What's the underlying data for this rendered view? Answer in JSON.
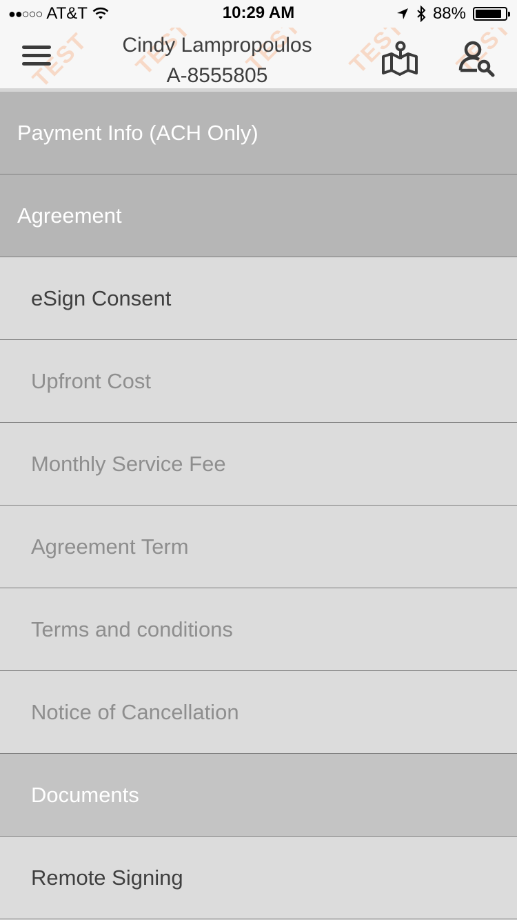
{
  "status_bar": {
    "signal_dots": "●●○○○",
    "carrier": "AT&T",
    "time": "10:29 AM",
    "battery_text": "88%",
    "battery_level": 0.88
  },
  "header": {
    "customer_name": "Cindy Lampropoulos",
    "account_id": "A-8555805",
    "watermark_text": "TEST"
  },
  "colors": {
    "section_bg": "#b6b6b6",
    "item_bg": "#dcdcdc",
    "watermark": "#f5a06e"
  },
  "icons": {
    "menu": "hamburger-menu-icon",
    "map": "map-pin-icon",
    "user_search": "user-search-icon"
  },
  "menu": {
    "payment_info": "Payment Info (ACH Only)",
    "agreement": "Agreement",
    "esign_consent": "eSign Consent",
    "upfront_cost": "Upfront Cost",
    "monthly_service_fee": "Monthly Service Fee",
    "agreement_term": "Agreement Term",
    "terms_and_conditions": "Terms and conditions",
    "notice_of_cancellation": "Notice of Cancellation",
    "documents": "Documents",
    "remote_signing": "Remote Signing"
  }
}
